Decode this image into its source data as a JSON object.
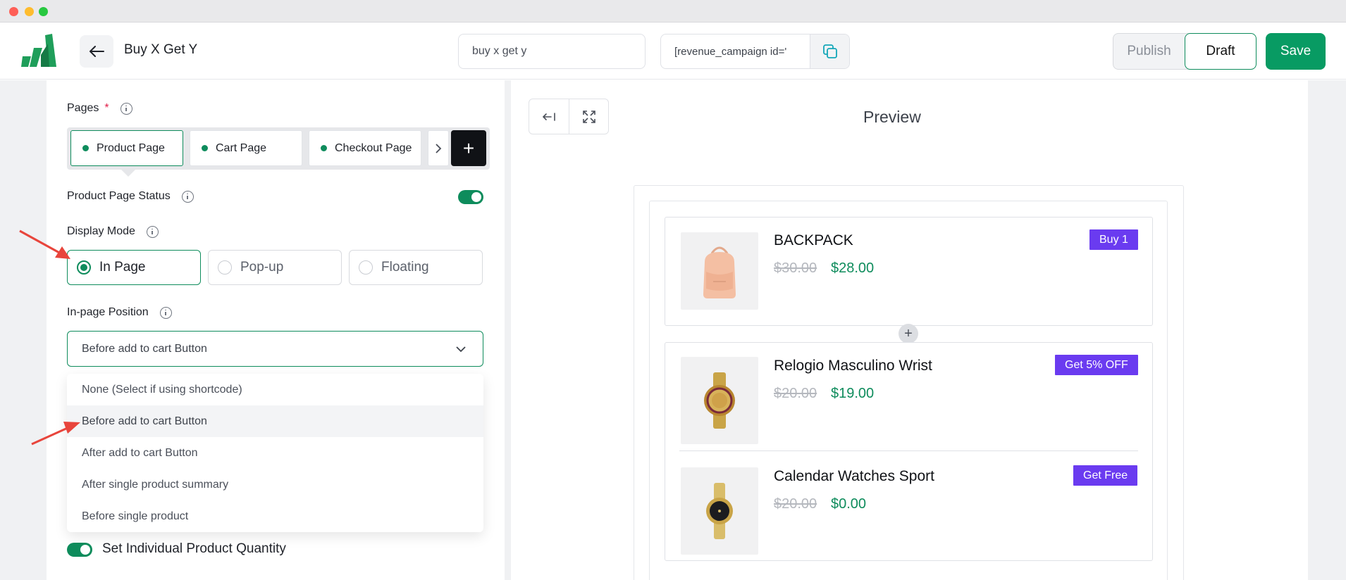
{
  "header": {
    "campaign_title": "Buy X Get Y",
    "campaign_name_value": "buy x get y",
    "shortcode_value": "[revenue_campaign id='",
    "publish_label": "Publish",
    "draft_label": "Draft",
    "save_label": "Save"
  },
  "settings": {
    "pages_label": "Pages",
    "required_mark": "*",
    "tabs": [
      {
        "label": "Product Page",
        "active": true
      },
      {
        "label": "Cart Page",
        "active": false
      },
      {
        "label": "Checkout Page",
        "active": false
      }
    ],
    "add_tab_symbol": "+",
    "status_label": "Product Page Status",
    "status_enabled": true,
    "display_mode_label": "Display Mode",
    "display_modes": [
      {
        "label": "In Page",
        "selected": true
      },
      {
        "label": "Pop-up",
        "selected": false
      },
      {
        "label": "Floating",
        "selected": false
      }
    ],
    "position_label": "In-page Position",
    "position_selected": "Before add to cart Button",
    "position_options": [
      "None (Select if using shortcode)",
      "Before add to cart Button",
      "After add to cart Button",
      "After single product summary",
      "Before single product"
    ],
    "quantity_toggle_label": "Set Individual Product Quantity",
    "quantity_toggle_enabled": true
  },
  "preview": {
    "title": "Preview",
    "products": [
      {
        "name": "BACKPACK",
        "old_price": "$30.00",
        "new_price": "$28.00",
        "badge": "Buy 1",
        "image": "backpack"
      },
      {
        "name": "Relogio Masculino Wrist",
        "old_price": "$20.00",
        "new_price": "$19.00",
        "badge": "Get 5% OFF",
        "image": "watch-gold-blue"
      },
      {
        "name": "Calendar Watches Sport",
        "old_price": "$20.00",
        "new_price": "$0.00",
        "badge": "Get Free",
        "image": "watch-gold-black"
      }
    ],
    "add_symbol": "+"
  },
  "colors": {
    "accent_green": "#0e8c5c",
    "save_green": "#089b63",
    "badge_purple": "#6a3bf0",
    "annotation_red": "#e8453c"
  }
}
